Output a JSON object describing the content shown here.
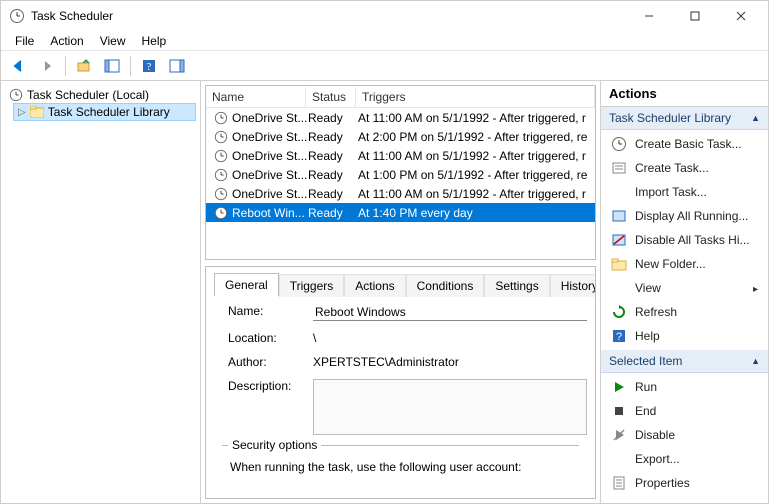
{
  "window": {
    "title": "Task Scheduler"
  },
  "menubar": {
    "file": "File",
    "action": "Action",
    "view": "View",
    "help": "Help"
  },
  "tree": {
    "root_label": "Task Scheduler (Local)",
    "library_label": "Task Scheduler Library"
  },
  "task_columns": {
    "name": "Name",
    "status": "Status",
    "triggers": "Triggers"
  },
  "tasks": [
    {
      "name": "OneDrive St...",
      "status": "Ready",
      "trigger": "At 11:00 AM on 5/1/1992 - After triggered, r"
    },
    {
      "name": "OneDrive St...",
      "status": "Ready",
      "trigger": "At 2:00 PM on 5/1/1992 - After triggered, re"
    },
    {
      "name": "OneDrive St...",
      "status": "Ready",
      "trigger": "At 11:00 AM on 5/1/1992 - After triggered, r"
    },
    {
      "name": "OneDrive St...",
      "status": "Ready",
      "trigger": "At 1:00 PM on 5/1/1992 - After triggered, re"
    },
    {
      "name": "OneDrive St...",
      "status": "Ready",
      "trigger": "At 11:00 AM on 5/1/1992 - After triggered, r"
    },
    {
      "name": "Reboot Win...",
      "status": "Ready",
      "trigger": "At 1:40 PM every day"
    }
  ],
  "details": {
    "tabs": {
      "general": "General",
      "triggers": "Triggers",
      "actions": "Actions",
      "conditions": "Conditions",
      "settings": "Settings",
      "history": "History"
    },
    "name_label": "Name:",
    "name_value": "Reboot Windows",
    "location_label": "Location:",
    "location_value": "\\",
    "author_label": "Author:",
    "author_value": "XPERTSTEC\\Administrator",
    "description_label": "Description:",
    "security_legend": "Security options",
    "security_text": "When running the task, use the following user account:"
  },
  "actions_pane": {
    "title": "Actions",
    "section1": "Task Scheduler Library",
    "items1": [
      "Create Basic Task...",
      "Create Task...",
      "Import Task...",
      "Display All Running...",
      "Disable All Tasks Hi...",
      "New Folder...",
      "View",
      "Refresh",
      "Help"
    ],
    "section2": "Selected Item",
    "items2": [
      "Run",
      "End",
      "Disable",
      "Export...",
      "Properties"
    ]
  }
}
